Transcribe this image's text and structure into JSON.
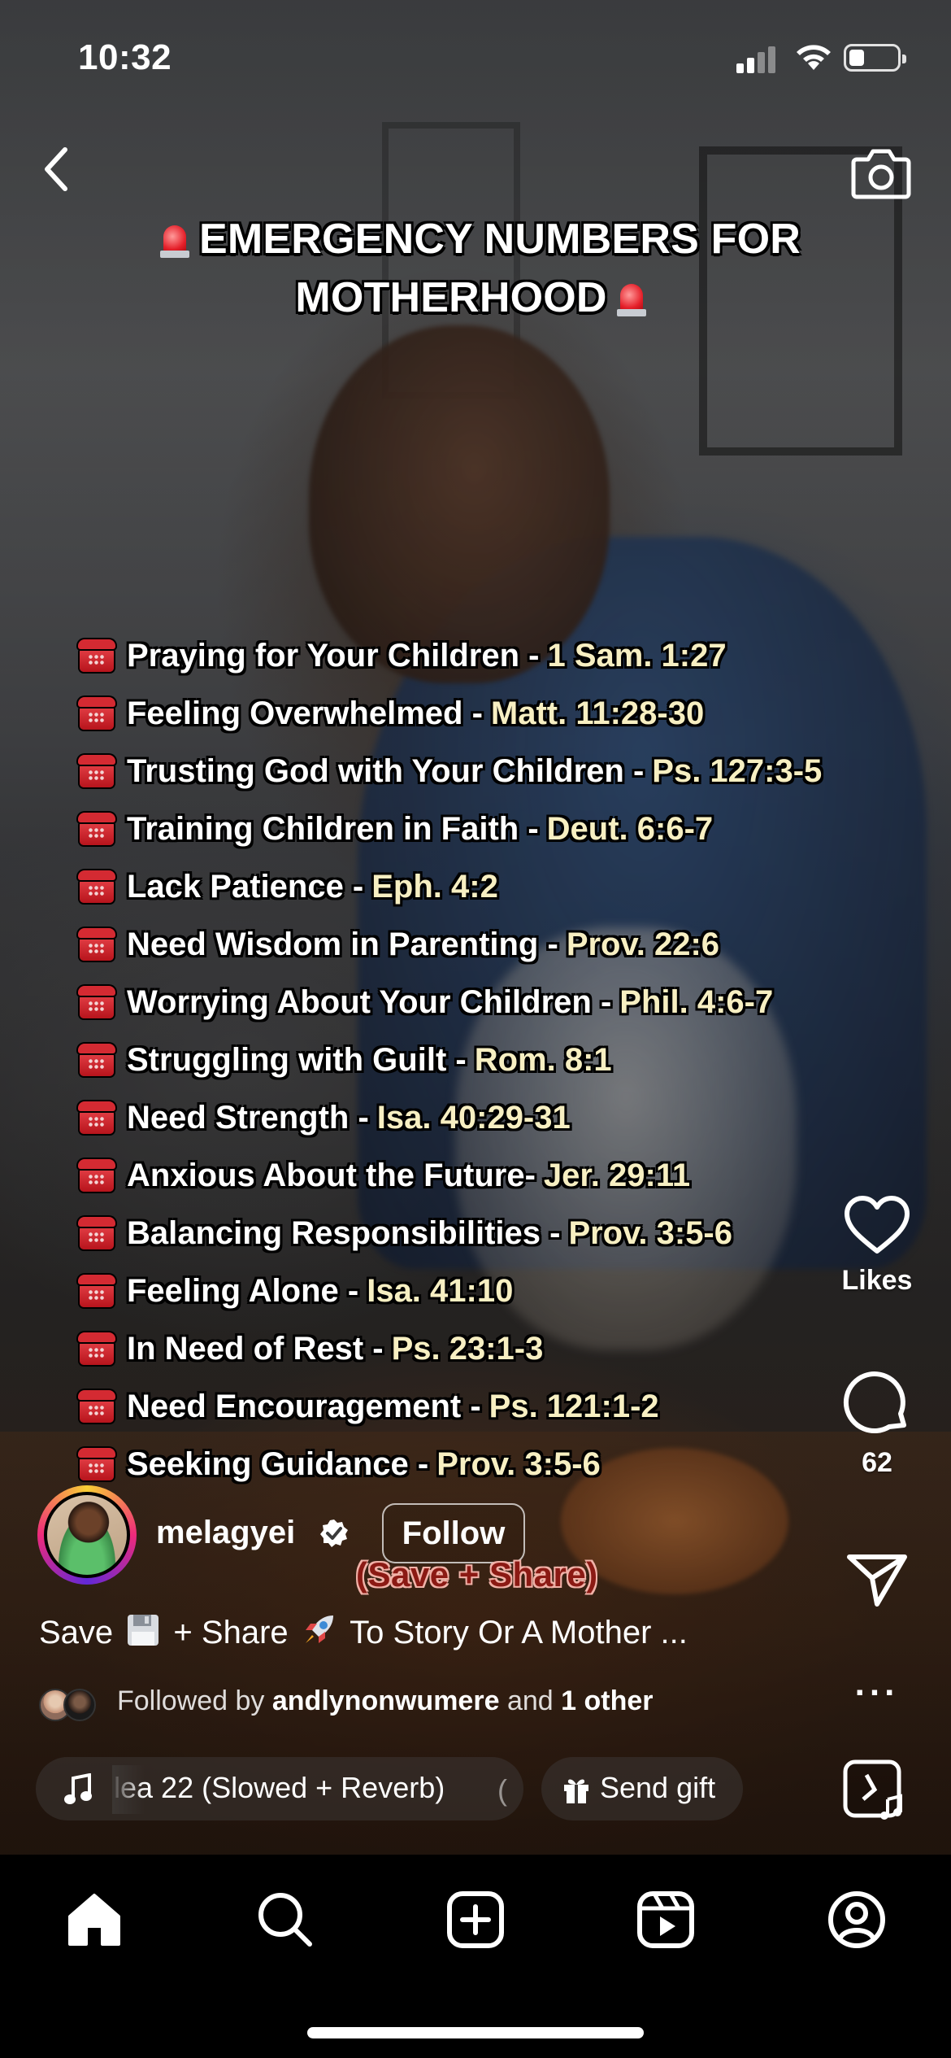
{
  "status_bar": {
    "time": "10:32"
  },
  "post": {
    "title_line1": "EMERGENCY NUMBERS FOR",
    "title_line2": "MOTHERHOOD",
    "items": [
      {
        "text": "Praying for Your Children -",
        "ref": "1 Sam. 1:27"
      },
      {
        "text": "Feeling Overwhelmed -",
        "ref": "Matt. 11:28-30"
      },
      {
        "text": "Trusting God with Your Children -",
        "ref": "Ps. 127:3-5"
      },
      {
        "text": "Training Children in Faith -",
        "ref": "Deut. 6:6-7"
      },
      {
        "text": "Lack Patience -",
        "ref": "Eph. 4:2"
      },
      {
        "text": "Need Wisdom in Parenting -",
        "ref": "Prov. 22:6"
      },
      {
        "text": "Worrying About Your Children -",
        "ref": "Phil. 4:6-7"
      },
      {
        "text": "Struggling with Guilt -",
        "ref": "Rom. 8:1"
      },
      {
        "text": "Need Strength -",
        "ref": "Isa. 40:29-31"
      },
      {
        "text": "Anxious About the Future-",
        "ref": "Jer. 29:11"
      },
      {
        "text": "Balancing Responsibilities -",
        "ref": "Prov. 3:5-6"
      },
      {
        "text": "Feeling Alone -",
        "ref": "Isa. 41:10"
      },
      {
        "text": "In Need of Rest -",
        "ref": "Ps. 23:1-3"
      },
      {
        "text": "Need Encouragement -",
        "ref": "Ps. 121:1-2"
      },
      {
        "text": "Seeking Guidance -",
        "ref": "Prov. 3:5-6"
      }
    ],
    "overlay_text": "(Save + Share)"
  },
  "rail": {
    "likes_label": "Likes",
    "comments_count": "62",
    "more_label": "..."
  },
  "account": {
    "username": "melagyei",
    "follow_label": "Follow"
  },
  "caption": {
    "part1": "Save",
    "part2": "+ Share",
    "part3": "To Story Or A Mother ..."
  },
  "followed_by": {
    "prefix": "Followed by",
    "user": "andlynonwumere",
    "middle": "and",
    "others": "1 other"
  },
  "music": {
    "track": "lea 22 (Slowed + Reverb)"
  },
  "gift": {
    "label": "Send gift"
  },
  "nav": {
    "items": [
      "home-icon",
      "search-icon",
      "create-icon",
      "reels-icon",
      "profile-icon"
    ]
  }
}
